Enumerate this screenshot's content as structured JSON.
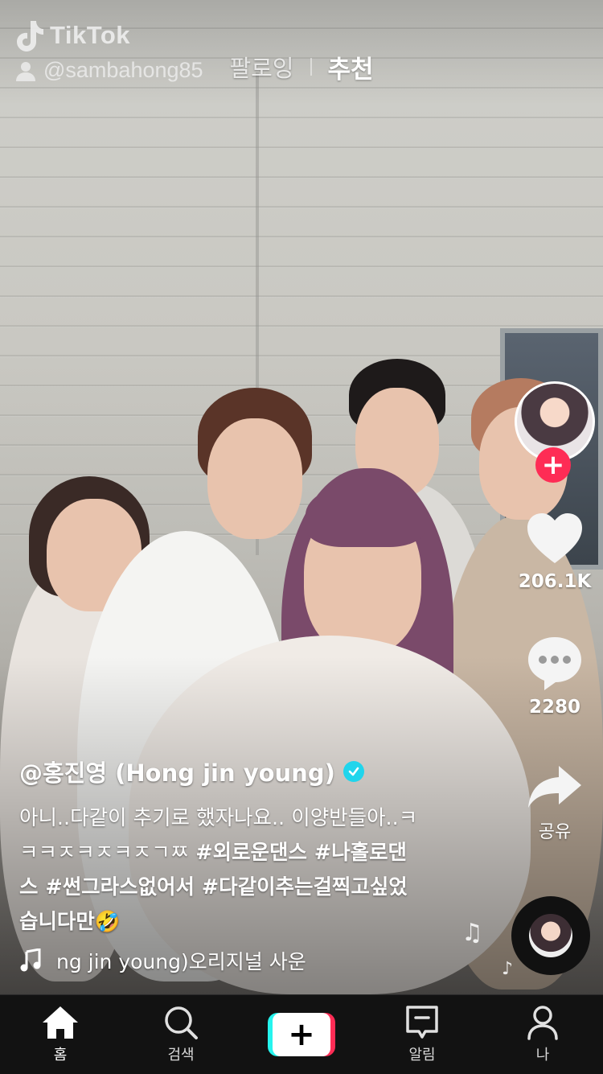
{
  "watermark": {
    "brand": "TikTok",
    "username": "@sambahong85"
  },
  "top_tabs": [
    {
      "label": "팔로잉",
      "active": false
    },
    {
      "label": "추천",
      "active": true
    }
  ],
  "rail": {
    "likes": "206.1K",
    "comments": "2280",
    "share_label": "공유"
  },
  "post": {
    "author": "@홍진영 (Hong jin young)",
    "description_plain": "아니..다같이 추기로 했자나요.. 이양반들아..ㅋㅋㅋㅈㅋㅈㅋㅈㄱㅉ ",
    "hashtags": [
      "#외로운댄스",
      "#나홀로댄스",
      "#썬그라스없어서",
      "#다같이추는걸찍고싶었습니다만"
    ],
    "emoji": "🤣",
    "line1": "아니..다같이 추기로 했자나요.. 이양반들아..ㅋ",
    "line2_plain": "ㅋㅋㅈㅋㅈㅋㅈㄱㅉ ",
    "line2_tags": "#외로운댄스 #나홀로댄",
    "line3": "스 #썬그라스없어서 #다같이추는걸찍고싶었",
    "line4": "습니다만"
  },
  "music": {
    "text": "ng jin young)오리지널 사운"
  },
  "bottom_nav": [
    {
      "label": "홈",
      "icon": "home-icon",
      "active": true
    },
    {
      "label": "검색",
      "icon": "search-icon",
      "active": false
    },
    {
      "label": "",
      "icon": "create-icon",
      "active": false
    },
    {
      "label": "알림",
      "icon": "inbox-icon",
      "active": false
    },
    {
      "label": "나",
      "icon": "profile-icon",
      "active": false
    }
  ],
  "colors": {
    "accent_red": "#fe2c55",
    "accent_cyan": "#25f4ee",
    "verified": "#20d5ec",
    "nav_bg": "#121212"
  }
}
